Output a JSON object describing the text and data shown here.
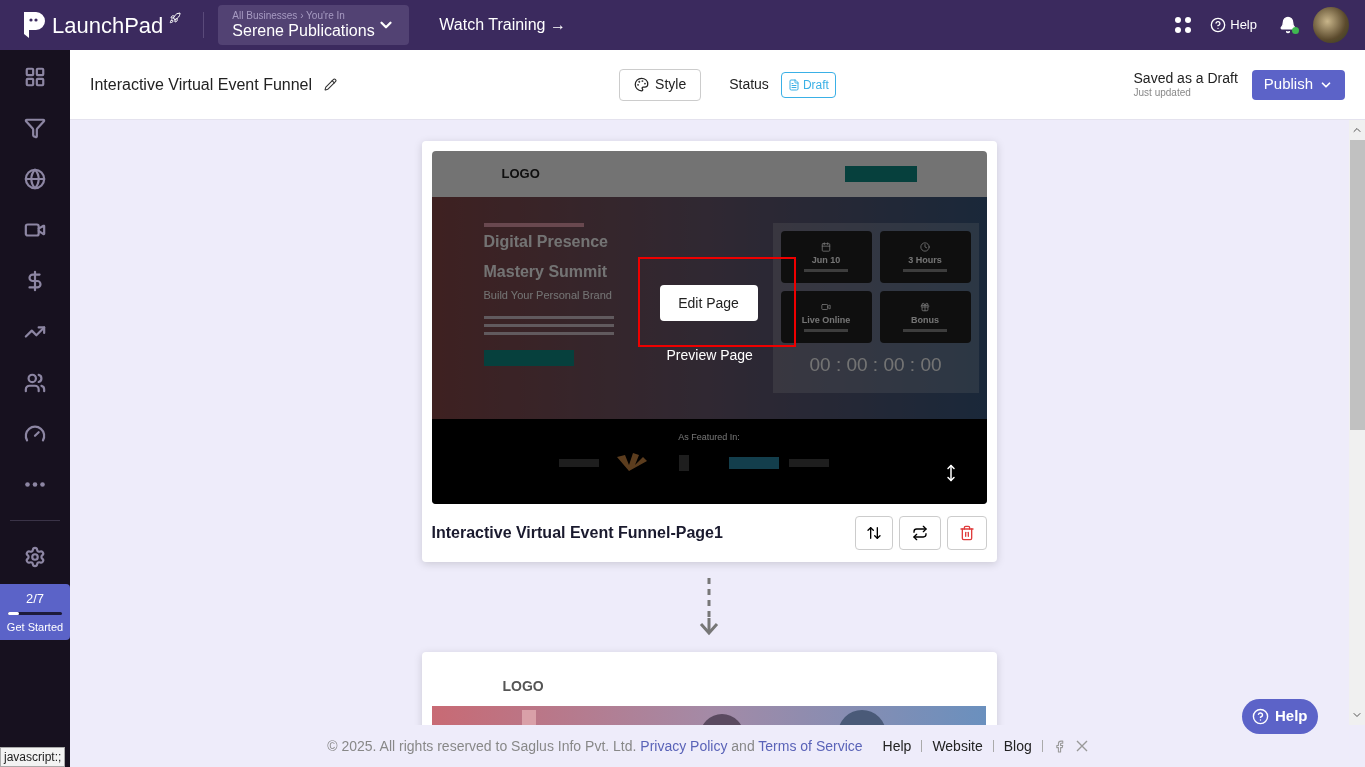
{
  "top_bar": {
    "brand": "LaunchPad",
    "breadcrumb": "All Businesses › You're In",
    "business": "Serene Publications",
    "watch_training": "Watch Training →",
    "help": "Help"
  },
  "sidebar": {
    "items": [
      {
        "kind": "dashboard"
      },
      {
        "kind": "funnels"
      },
      {
        "kind": "websites"
      },
      {
        "kind": "video"
      },
      {
        "kind": "payments"
      },
      {
        "kind": "sales"
      },
      {
        "kind": "contacts"
      },
      {
        "kind": "analytics"
      },
      {
        "kind": "more"
      }
    ],
    "settings": {
      "kind": "settings"
    },
    "progress": {
      "count": "2/7",
      "label": "Get Started",
      "level": 0.2
    }
  },
  "header": {
    "title": "Interactive Virtual Event Funnel",
    "style_button": "Style",
    "status_label": "Status",
    "status_badge": "Draft",
    "save_state": "Saved as a Draft",
    "save_time": "Just updated",
    "publish_button": "Publish"
  },
  "page_card": {
    "name": "Interactive Virtual Event Funnel-Page1",
    "hovered": true,
    "edit_button": "Edit Page",
    "preview_link": "Preview Page",
    "thumbnail": {
      "logo": "LOGO",
      "headline": [
        "Digital Presence",
        "Mastery Summit"
      ],
      "subtitle": "Build Your Personal Brand",
      "tiles": [
        {
          "kind": "calendar",
          "title": "Jun 10"
        },
        {
          "kind": "clock",
          "title": "3 Hours"
        },
        {
          "kind": "video",
          "title": "Live Online"
        },
        {
          "kind": "gift",
          "title": "Bonus"
        }
      ],
      "countdown": "00 : 00 : 00 : 00",
      "featured": "As Featured In:"
    }
  },
  "next_card": {
    "logo": "LOGO"
  },
  "footer": {
    "copyright": "©  2025. All rights reserved to Saglus Info Pvt. Ltd.",
    "privacy_link": "Privacy Policy",
    "and": "and",
    "terms_link": "Terms of Service",
    "links": [
      "Help",
      "Website",
      "Blog"
    ]
  },
  "help_button": "Help",
  "status_tooltip": "javascript:;"
}
